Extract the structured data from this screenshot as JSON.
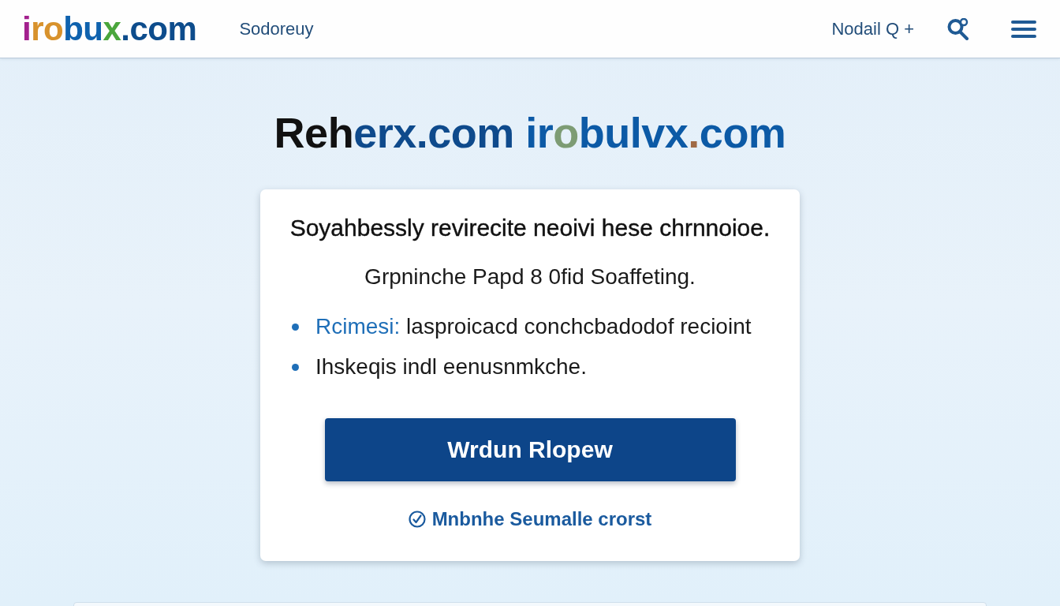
{
  "header": {
    "logo": [
      {
        "text": "i",
        "color": "#a3218e"
      },
      {
        "text": "ro",
        "color": "#d8922c"
      },
      {
        "text": "bu",
        "color": "#0f62ae"
      },
      {
        "text": "x",
        "color": "#4aa63c"
      },
      {
        "text": ".com",
        "color": "#0d4c8c"
      }
    ],
    "nav_link": "Sodoreuy",
    "account_link": "Nodail Q +"
  },
  "hero": {
    "title": [
      {
        "text": "Reh",
        "color": "#111111"
      },
      {
        "text": "erx.com",
        "color": "#0e4a8c"
      },
      {
        "text": " ir",
        "color": "#0c5aa6"
      },
      {
        "text": "o",
        "color": "#7d9c74"
      },
      {
        "text": "bulvx",
        "color": "#0c5aa6"
      },
      {
        "text": ".",
        "color": "#a06a45"
      },
      {
        "text": "com",
        "color": "#0c5aa6"
      }
    ]
  },
  "card": {
    "heading": "Soyahbessly revirecite neoivi hese chrnnoioe.",
    "subtitle": "Grpninche Papd 8 0fid Soaffeting.",
    "bullets": [
      {
        "label": "Rcimesi:",
        "text": "lasproicacd conchcbadodof recioint"
      },
      {
        "text": "Ihskeqis indl eenusnmkche."
      }
    ],
    "button": "Wrdun Rlopew",
    "link": "Mnbnhe Seumalle crorst"
  }
}
